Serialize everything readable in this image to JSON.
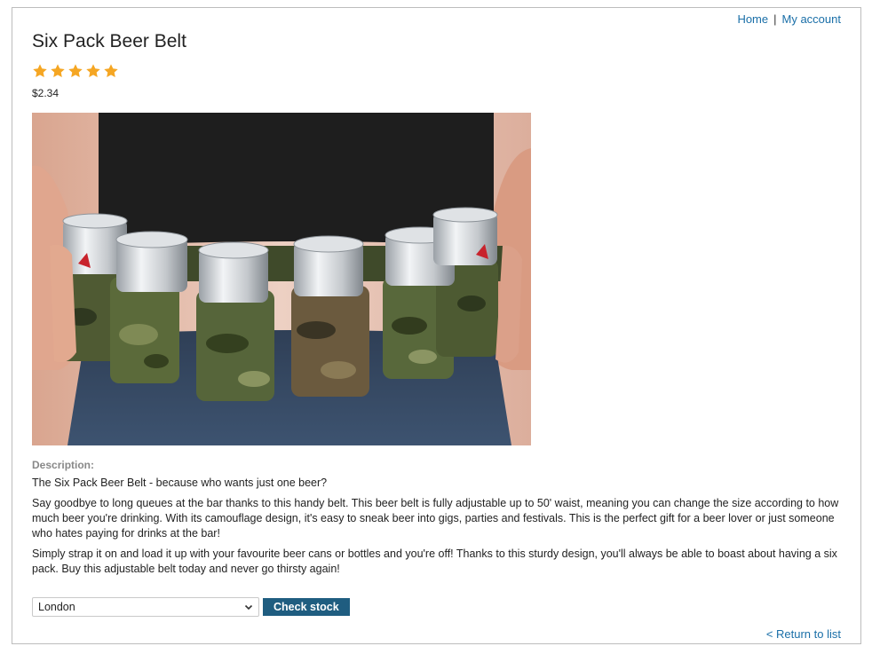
{
  "nav": {
    "home": "Home",
    "separator": "|",
    "account": "My account"
  },
  "product": {
    "title": "Six Pack Beer Belt",
    "rating": 5,
    "rating_max": 5,
    "star_color": "#f5a623",
    "price": "$2.34"
  },
  "description": {
    "label": "Description:",
    "paragraphs": [
      "The Six Pack Beer Belt - because who wants just one beer?",
      "Say goodbye to long queues at the bar thanks to this handy belt. This beer belt is fully adjustable up to 50' waist, meaning you can change the size according to how much beer you're drinking. With its camouflage design, it's easy to sneak beer into gigs, parties and festivals. This is the perfect gift for a beer lover or just someone who hates paying for drinks at the bar!",
      "Simply strap it on and load it up with your favourite beer cans or bottles and you're off! Thanks to this sturdy design, you'll always be able to boast about having a six pack. Buy this adjustable belt today and never go thirsty again!"
    ]
  },
  "stock": {
    "selected_location": "London",
    "button_label": "Check stock",
    "button_color": "#1f5d80"
  },
  "footer": {
    "return_link": "< Return to list"
  },
  "colors": {
    "link": "#1a6fa8"
  }
}
